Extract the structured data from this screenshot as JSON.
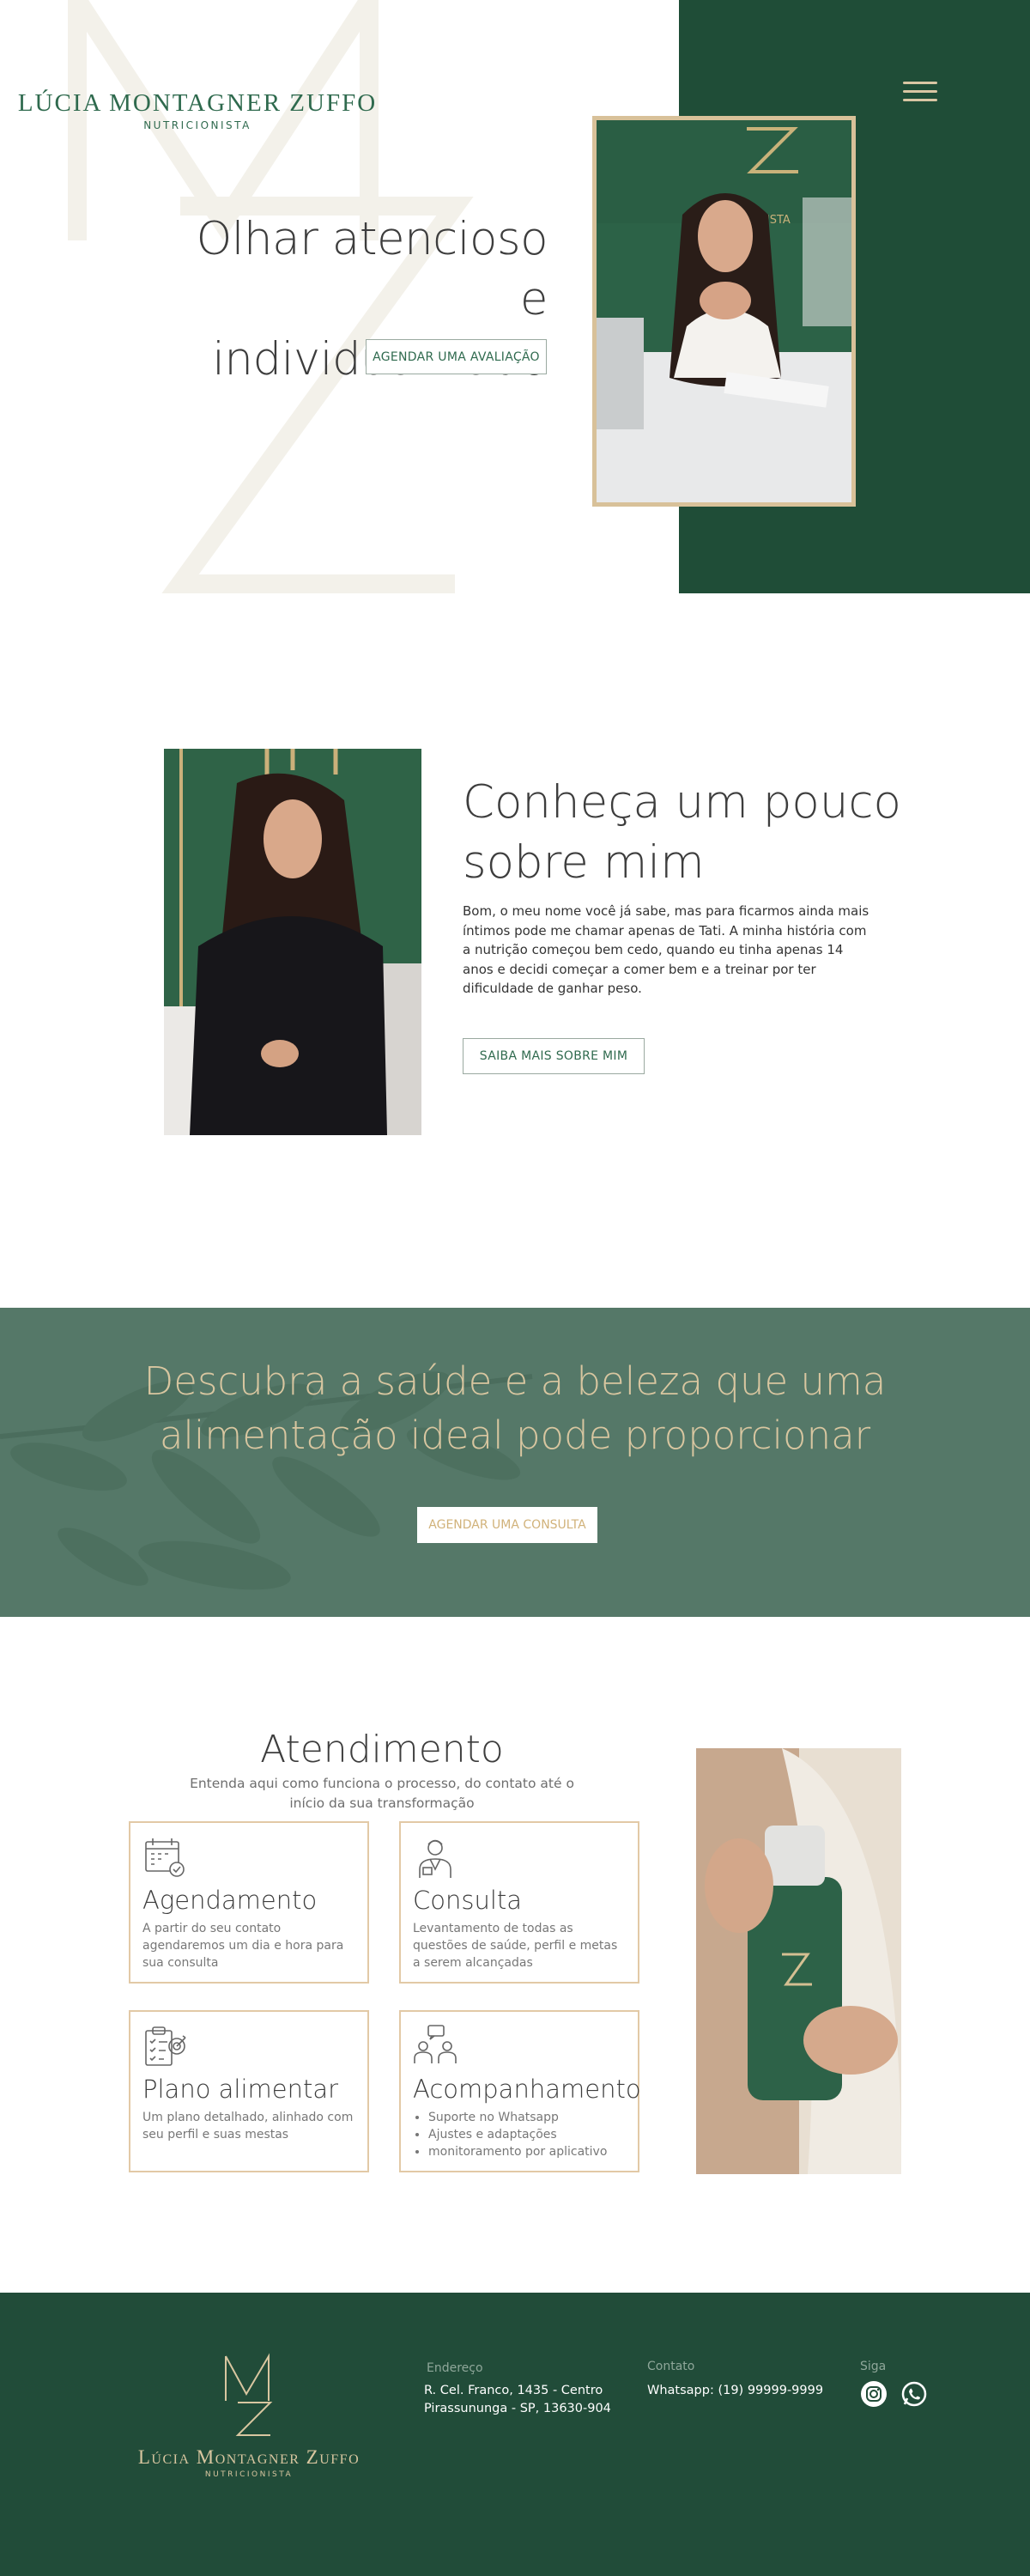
{
  "brand": {
    "name": "LÚCIA MONTAGNER ZUFFO",
    "subtitle": "NUTRICIONISTA"
  },
  "hero": {
    "title_line1": "Olhar atencioso",
    "title_line2": "e individualizado",
    "cta": "AGENDAR UMA AVALIAÇÃO"
  },
  "about": {
    "title_line1": "Conheça um pouco",
    "title_line2": "sobre mim",
    "text": "Bom, o meu nome você já sabe, mas para ficarmos ainda mais íntimos pode me chamar apenas de Tati. A minha história com a nutrição começou bem cedo, quando eu tinha apenas 14 anos e decidi começar a comer bem e a treinar por ter dificuldade de ganhar peso.",
    "cta": "SAIBA MAIS SOBRE MIM"
  },
  "banner": {
    "title_line1": "Descubra a saúde e a beleza que uma",
    "title_line2": "alimentação ideal pode proporcionar",
    "cta": "AGENDAR UMA CONSULTA"
  },
  "atendimento": {
    "title": "Atendimento",
    "subtitle": "Entenda aqui como funciona o processo, do contato até o início da sua transformação",
    "cards": [
      {
        "title": "Agendamento",
        "icon": "calendar-icon",
        "text": "A partir do seu contato agendaremos um dia e hora para sua consulta"
      },
      {
        "title": "Consulta",
        "icon": "doctor-icon",
        "text": "Levantamento de todas as questões de saúde, perfil e metas a serem alcançadas"
      },
      {
        "title": "Plano alimentar",
        "icon": "clipboard-target-icon",
        "text": "Um plano detalhado, alinhado com seu perfil e suas mestas"
      },
      {
        "title": "Acompanhamento",
        "icon": "chat-people-icon",
        "items": [
          "Suporte no Whatsapp",
          "Ajustes e adaptações",
          "monitoramento por aplicativo"
        ]
      }
    ]
  },
  "footer": {
    "brand_name": "Lúcia Montagner Zuffo",
    "brand_subtitle": "NUTRICIONISTA",
    "address_label": "Endereço",
    "address_line1": "R. Cel. Franco, 1435 - Centro",
    "address_line2": "Pirassununga - SP, 13630-904",
    "contact_label": "Contato",
    "contact_text": "Whatsapp: (19) 99999-9999",
    "follow_label": "Siga",
    "social": [
      "instagram-icon",
      "whatsapp-icon"
    ]
  },
  "colors": {
    "dark_green": "#1f4d37",
    "muted_green": "#557868",
    "gold": "#d8c199",
    "brand_green": "#2f6a4e"
  }
}
